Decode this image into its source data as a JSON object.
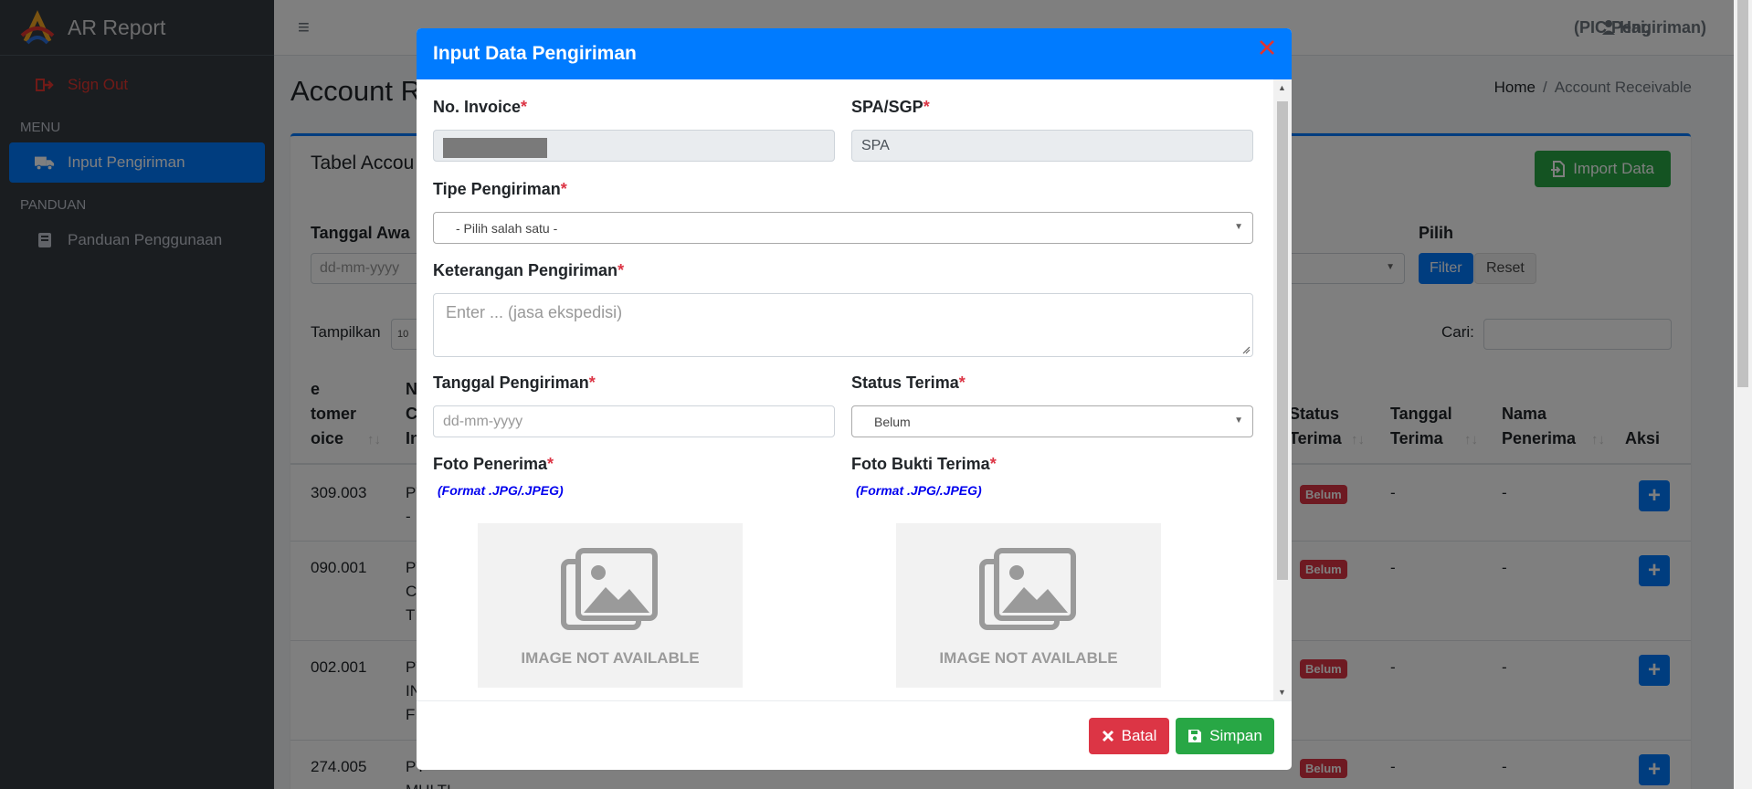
{
  "app": {
    "brand": "AR Report"
  },
  "sidebar": {
    "sign_out": "Sign Out",
    "menu_header": "MENU",
    "menu_item": "Input Pengiriman",
    "panduan_header": "PANDUAN",
    "panduan_item": "Panduan Penggunaan"
  },
  "topbar": {
    "greeting": "Hai,",
    "role": "(PIC Pengiriman)"
  },
  "page": {
    "title": "Account R",
    "breadcrumb_home": "Home",
    "breadcrumb_sep": "/",
    "breadcrumb_current": "Account Receivable",
    "card_title": "Tabel Accou",
    "import_button": "Import Data",
    "filter_label_start": "Tanggal Awa",
    "date_placeholder": "dd-mm-yyyy",
    "pilih_label": "Pilih",
    "filter_button": "Filter",
    "reset_button": "Reset",
    "show_label": "Tampilkan",
    "show_value": "10",
    "search_label": "Cari:"
  },
  "table": {
    "headers": {
      "col1": [
        "e",
        "tomer",
        "oice"
      ],
      "col2": [
        "N",
        "C",
        "In"
      ],
      "status": [
        "Status",
        "Terima"
      ],
      "tanggal": [
        "Tanggal",
        "Terima"
      ],
      "nama": [
        "Nama",
        "Penerima"
      ],
      "aksi": "Aksi"
    },
    "rows": [
      {
        "col1": "309.003",
        "col2": [
          "PT",
          "-"
        ],
        "status": "Belum",
        "tanggal": "-",
        "nama": "-"
      },
      {
        "col1": "090.001",
        "col2": [
          "PT",
          "C",
          "TI"
        ],
        "status": "Belum",
        "tanggal": "-",
        "nama": "-"
      },
      {
        "col1": "002.001",
        "col2": [
          "PT",
          "IN",
          "FI"
        ],
        "status": "Belum",
        "tanggal": "-",
        "nama": "-"
      },
      {
        "col1": "274.005",
        "col2": [
          "PT",
          "MULTI"
        ],
        "status": "Belum",
        "tanggal": "-",
        "nama": "-"
      }
    ]
  },
  "modal": {
    "title": "Input Data Pengiriman",
    "no_invoice_label": "No. Invoice",
    "spa_label": "SPA/SGP",
    "spa_value": "SPA",
    "tipe_label": "Tipe Pengiriman",
    "tipe_placeholder": "- Pilih salah satu -",
    "keterangan_label": "Keterangan Pengiriman",
    "keterangan_placeholder": "Enter ... (jasa ekspedisi)",
    "tanggal_label": "Tanggal Pengiriman",
    "tanggal_placeholder": "dd-mm-yyyy",
    "status_label": "Status Terima",
    "status_value": "Belum",
    "foto_penerima_label": "Foto Penerima",
    "foto_bukti_label": "Foto Bukti Terima",
    "format_hint": "(Format .JPG/.JPEG)",
    "image_na": "IMAGE NOT AVAILABLE",
    "required_mark": "*",
    "batal_button": "Batal",
    "simpan_button": "Simpan"
  },
  "colors": {
    "primary": "#007bff",
    "success": "#28a745",
    "danger": "#dc3545",
    "sidebar_bg": "#343a40"
  },
  "icons": [
    "logo-icon",
    "sign-out-icon",
    "truck-icon",
    "book-icon",
    "hamburger-icon",
    "user-icon",
    "import-icon",
    "close-icon",
    "times-icon",
    "save-icon",
    "image-placeholder-icon",
    "plus-icon"
  ]
}
